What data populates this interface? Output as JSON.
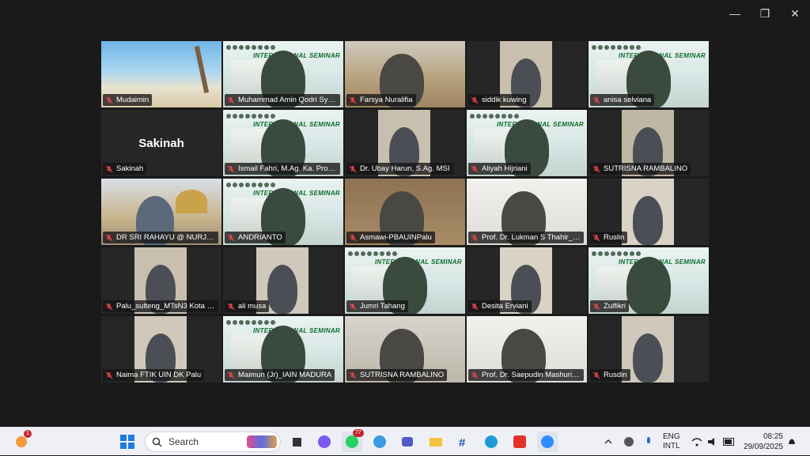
{
  "window": {
    "controls": {
      "minimize": "—",
      "maximize": "❐",
      "close": "✕"
    }
  },
  "participants": [
    {
      "name": "Mudaimin",
      "bg": "beach"
    },
    {
      "name": "Muhammad Amin Qodri Sya...",
      "bg": "seminar"
    },
    {
      "name": "Farsya Nuralifia",
      "bg": "office"
    },
    {
      "name": "siddik kuwing",
      "bg": "dark"
    },
    {
      "name": "anisa selviana",
      "bg": "seminar"
    },
    {
      "name": "Sakinah",
      "bg": "dark",
      "big_label": "Sakinah"
    },
    {
      "name": "Ismail Fahri, M.Ag. Ka. Prodi ...",
      "bg": "seminar",
      "active": true
    },
    {
      "name": "Dr. Ubay Harun, S.Ag. MSI",
      "bg": "dark"
    },
    {
      "name": "Aliyah Hijriani",
      "bg": "seminar"
    },
    {
      "name": "SUTRISNA RAMBALINO",
      "bg": "dark"
    },
    {
      "name": "DR SRI RAHAYU @ NURJAN...",
      "bg": "mosque"
    },
    {
      "name": "ANDRIANTO",
      "bg": "seminar"
    },
    {
      "name": "Asmawi-PBAUINPalu",
      "bg": "wood"
    },
    {
      "name": "Prof. Dr. Lukman S Thahir_P...",
      "bg": "white"
    },
    {
      "name": "Ruslin",
      "bg": "dark"
    },
    {
      "name": "Palu_sulteng_MTsN3 Kota P...",
      "bg": "dark"
    },
    {
      "name": "ali musa",
      "bg": "dark"
    },
    {
      "name": "Jumri Tahang",
      "bg": "seminar"
    },
    {
      "name": "Desita Erviani",
      "bg": "dark"
    },
    {
      "name": "Zulfikri",
      "bg": "seminar"
    },
    {
      "name": "Naima FTIK UIN DK Palu",
      "bg": "dark"
    },
    {
      "name": "Maimun (Jr)_IAIN MADURA",
      "bg": "seminar"
    },
    {
      "name": "SUTRISNA RAMBALINO",
      "bg": "room"
    },
    {
      "name": "Prof. Dr. Saepudin Mashuri, ...",
      "bg": "white"
    },
    {
      "name": "Rusdin",
      "bg": "dark"
    }
  ],
  "seminar_banner": "INTERNATIONAL SEMINAR",
  "taskbar": {
    "search_placeholder": "Search",
    "notification_count": "1",
    "whatsapp_count": "77",
    "language_top": "ENG",
    "language_bottom": "INTL",
    "time": "08:25",
    "date": "29/09/2025"
  }
}
